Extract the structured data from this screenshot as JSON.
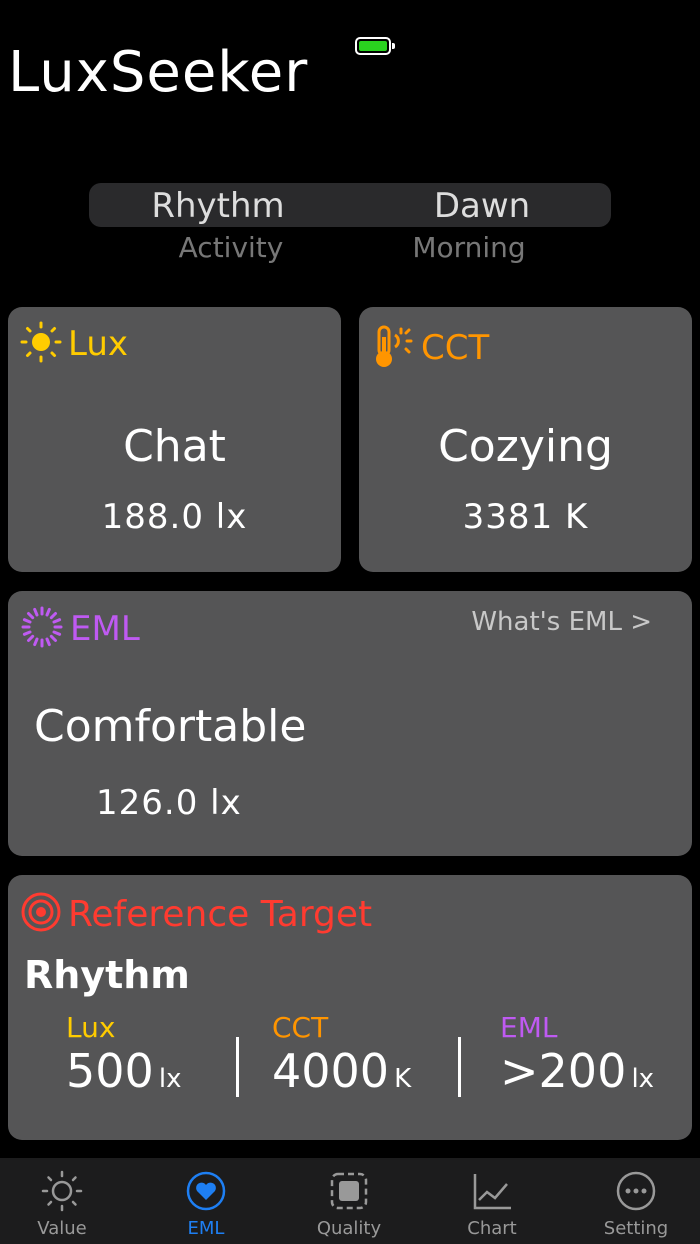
{
  "app": {
    "title": "LuxSeeker"
  },
  "picker": {
    "left": {
      "selected": "Rhythm",
      "next": "Activity"
    },
    "right": {
      "selected": "Dawn",
      "next": "Morning"
    }
  },
  "cards": {
    "lux": {
      "label": "Lux",
      "status": "Chat",
      "value": "188.0 lx",
      "color": "#ffcc00"
    },
    "cct": {
      "label": "CCT",
      "status": "Cozying",
      "value": "3381 K",
      "color": "#ff9500"
    },
    "eml": {
      "label": "EML",
      "link": "What's EML >",
      "status": "Comfortable",
      "value": "126.0 lx",
      "color": "#bf5af2"
    }
  },
  "reference": {
    "title": "Reference Target",
    "mode": "Rhythm",
    "items": [
      {
        "label": "Lux",
        "value": "500",
        "unit": "lx"
      },
      {
        "label": "CCT",
        "value": "4000",
        "unit": "K"
      },
      {
        "label": "EML",
        "value": ">200",
        "unit": "lx"
      }
    ],
    "color": "#ff3b30"
  },
  "tabs": [
    {
      "label": "Value",
      "icon": "sun-icon"
    },
    {
      "label": "EML",
      "icon": "heart-icon",
      "active": true
    },
    {
      "label": "Quality",
      "icon": "quality-icon"
    },
    {
      "label": "Chart",
      "icon": "chart-icon"
    },
    {
      "label": "Setting",
      "icon": "ellipsis-icon"
    }
  ]
}
